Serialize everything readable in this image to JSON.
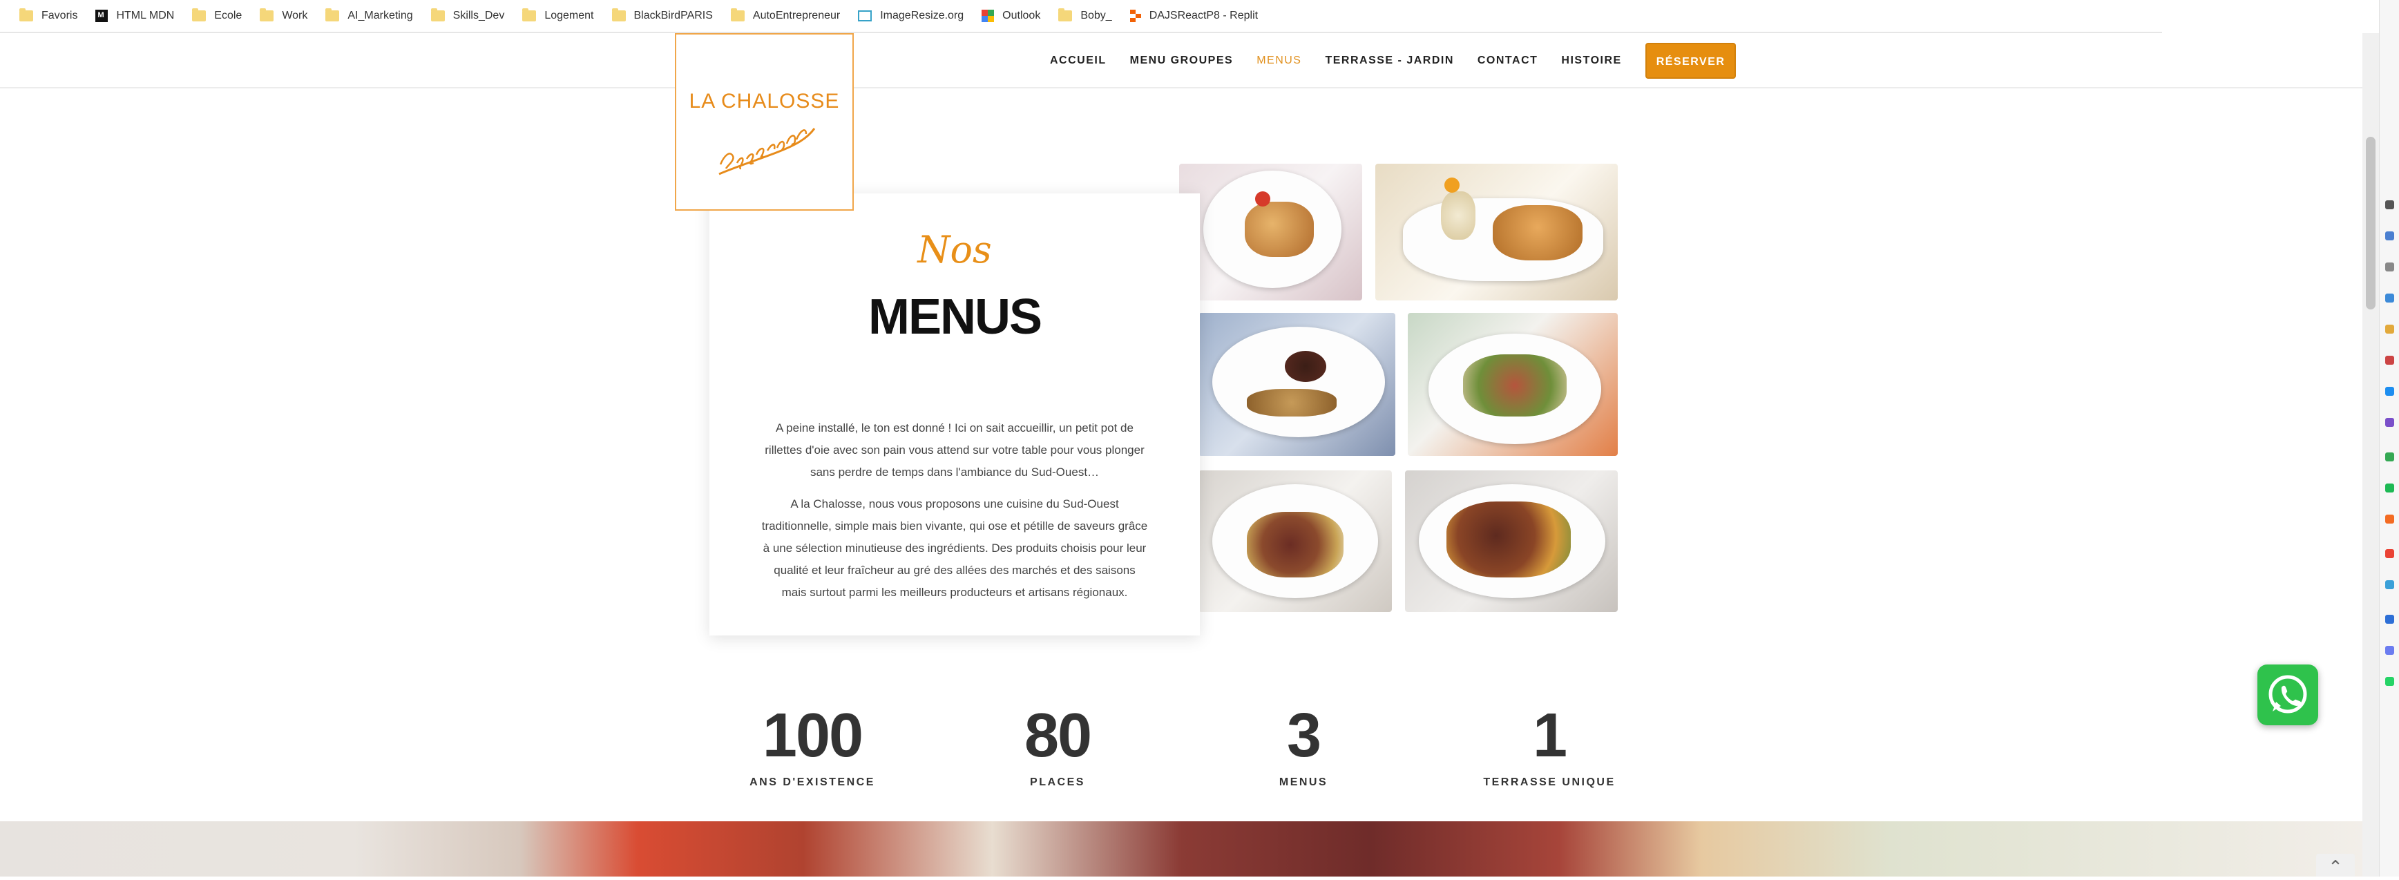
{
  "bookmarks": [
    {
      "label": "Favoris",
      "icon": "folder-icon"
    },
    {
      "label": "HTML MDN",
      "icon": "mdn-icon"
    },
    {
      "label": "Ecole",
      "icon": "folder-icon"
    },
    {
      "label": "Work",
      "icon": "folder-icon"
    },
    {
      "label": "AI_Marketing",
      "icon": "folder-icon"
    },
    {
      "label": "Skills_Dev",
      "icon": "folder-icon"
    },
    {
      "label": "Logement",
      "icon": "folder-icon"
    },
    {
      "label": "BlackBirdPARIS",
      "icon": "folder-icon"
    },
    {
      "label": "AutoEntrepreneur",
      "icon": "folder-icon"
    },
    {
      "label": "ImageResize.org",
      "icon": "image-resize-icon"
    },
    {
      "label": "Outlook",
      "icon": "outlook-icon"
    },
    {
      "label": "Boby_",
      "icon": "folder-icon"
    },
    {
      "label": "DAJSReactP8 - Replit",
      "icon": "replit-icon"
    }
  ],
  "logo": {
    "name": "LA CHALOSSE",
    "tagline": "L'Esprit Sud-Ouest"
  },
  "nav": {
    "items": [
      "ACCUEIL",
      "MENU GROUPES",
      "MENUS",
      "TERRASSE - JARDIN",
      "CONTACT",
      "HISTOIRE"
    ],
    "active": "MENUS",
    "reserve": "RÉSERVER"
  },
  "section": {
    "script_title": "Nos",
    "title": "MENUS",
    "paragraph1": "A peine installé, le ton est donné ! Ici on sait accueillir, un petit pot de rillettes d'oie avec son pain vous attend sur votre table pour vous plonger sans perdre de temps dans l'ambiance du Sud-Ouest…",
    "paragraph2": "A la Chalosse, nous vous proposons une cuisine du Sud-Ouest traditionnelle, simple mais bien vivante, qui ose et pétille de saveurs grâce à une sélection minutieuse des ingrédients. Des produits choisis pour leur qualité et leur fraîcheur au gré des allées des marchés et des saisons mais surtout parmi les meilleurs producteurs et artisans régionaux."
  },
  "counters": [
    {
      "value": "100",
      "label": "ANS D'EXISTENCE"
    },
    {
      "value": "80",
      "label": "PLACES"
    },
    {
      "value": "3",
      "label": "MENUS"
    },
    {
      "value": "1",
      "label": "TERRASSE UNIQUE"
    }
  ],
  "colors": {
    "accent": "#e68e0f",
    "whatsapp": "#2fc24c"
  }
}
